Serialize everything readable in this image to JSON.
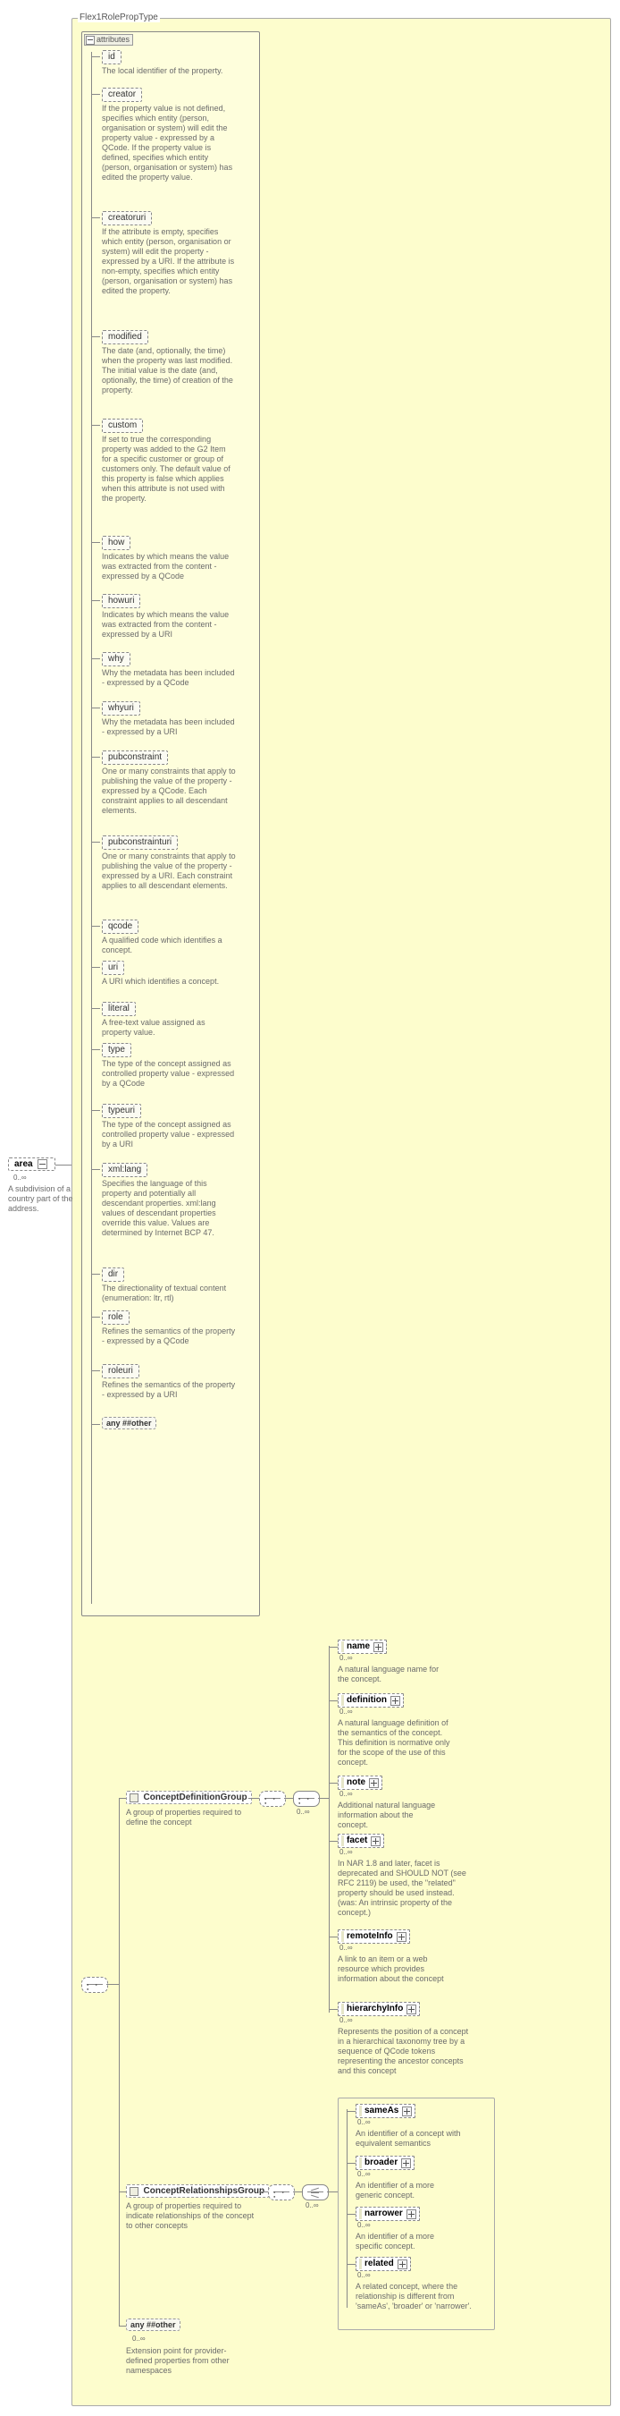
{
  "root_type": "Flex1RolePropType",
  "area": {
    "label": "area",
    "occurrence": "0..∞",
    "desc": "A subdivision of a country part of the address."
  },
  "attributes_header": "attributes",
  "attributes": [
    {
      "name": "id",
      "desc": "The local identifier of the property."
    },
    {
      "name": "creator",
      "desc": "If the property value is not defined, specifies which entity (person, organisation or system) will edit the property value - expressed by a QCode. If the property value is defined, specifies which entity (person, organisation or system) has edited the property value."
    },
    {
      "name": "creatoruri",
      "desc": "If the attribute is empty, specifies which entity (person, organisation or system) will edit the property - expressed by a URI. If the attribute is non-empty, specifies which entity (person, organisation or system) has edited the property."
    },
    {
      "name": "modified",
      "desc": "The date (and, optionally, the time) when the property was last modified. The initial value is the date (and, optionally, the time) of creation of the property."
    },
    {
      "name": "custom",
      "desc": "If set to true the corresponding property was added to the G2 Item for a specific customer or group of customers only. The default value of this property is false which applies when this attribute is not used with the property."
    },
    {
      "name": "how",
      "desc": "Indicates by which means the value was extracted from the content - expressed by a QCode"
    },
    {
      "name": "howuri",
      "desc": "Indicates by which means the value was extracted from the content - expressed by a URI"
    },
    {
      "name": "why",
      "desc": "Why the metadata has been included - expressed by a QCode"
    },
    {
      "name": "whyuri",
      "desc": "Why the metadata has been included - expressed by a URI"
    },
    {
      "name": "pubconstraint",
      "desc": "One or many constraints that apply to publishing the value of the property - expressed by a QCode. Each constraint applies to all descendant elements."
    },
    {
      "name": "pubconstrainturi",
      "desc": "One or many constraints that apply to publishing the value of the property - expressed by a URI. Each constraint applies to all descendant elements."
    },
    {
      "name": "qcode",
      "desc": "A qualified code which identifies a concept."
    },
    {
      "name": "uri",
      "desc": "A URI which identifies a concept."
    },
    {
      "name": "literal",
      "desc": "A free-text value assigned as property value."
    },
    {
      "name": "type",
      "desc": "The type of the concept assigned as controlled property value - expressed by a QCode"
    },
    {
      "name": "typeuri",
      "desc": "The type of the concept assigned as controlled property value - expressed by a URI"
    },
    {
      "name": "xml:lang",
      "desc": "Specifies the language of this property and potentially all descendant properties. xml:lang values of descendant properties override this value. Values are determined by Internet BCP 47."
    },
    {
      "name": "dir",
      "desc": "The directionality of textual content (enumeration: ltr, rtl)"
    },
    {
      "name": "role",
      "desc": "Refines the semantics of the property - expressed by a QCode"
    },
    {
      "name": "roleuri",
      "desc": "Refines the semantics of the property - expressed by a URI"
    }
  ],
  "attr_any": "any  ##other",
  "concept_def_group": {
    "label": "ConceptDefinitionGroup",
    "desc": "A group of properties required to define the concept"
  },
  "concept_rel_group": {
    "label": "ConceptRelationshipsGroup",
    "desc": "A group of properties required to indicate relationships of the concept to other concepts"
  },
  "def_items": [
    {
      "name": "name",
      "occ": "0..∞",
      "desc": "A natural language name for the concept."
    },
    {
      "name": "definition",
      "occ": "0..∞",
      "desc": "A natural language definition of the semantics of the concept. This definition is normative only for the scope of the use of this concept."
    },
    {
      "name": "note",
      "occ": "0..∞",
      "desc": "Additional natural language information about the concept."
    },
    {
      "name": "facet",
      "occ": "0..∞",
      "desc": "In NAR 1.8 and later, facet is deprecated and SHOULD NOT (see RFC 2119) be used, the \"related\" property should be used instead.(was: An intrinsic property of the concept.)"
    },
    {
      "name": "remoteInfo",
      "occ": "0..∞",
      "desc": "A link to an item or a web resource which provides information about the concept"
    },
    {
      "name": "hierarchyInfo",
      "occ": "0..∞",
      "desc": "Represents the position of a concept in a hierarchical taxonomy tree by a sequence of QCode tokens representing the ancestor concepts and this concept"
    }
  ],
  "rel_items": [
    {
      "name": "sameAs",
      "occ": "0..∞",
      "desc": "An identifier of a concept with equivalent semantics"
    },
    {
      "name": "broader",
      "occ": "0..∞",
      "desc": "An identifier of a more generic concept."
    },
    {
      "name": "narrower",
      "occ": "0..∞",
      "desc": "An identifier of a more specific concept."
    },
    {
      "name": "related",
      "occ": "0..∞",
      "desc": "A related concept, where the relationship is different from 'sameAs', 'broader' or 'narrower'."
    }
  ],
  "bottom_any": {
    "label": "any  ##other",
    "occ": "0..∞",
    "desc": "Extension point for provider-defined properties from other namespaces"
  },
  "occ_generic": "0..∞"
}
